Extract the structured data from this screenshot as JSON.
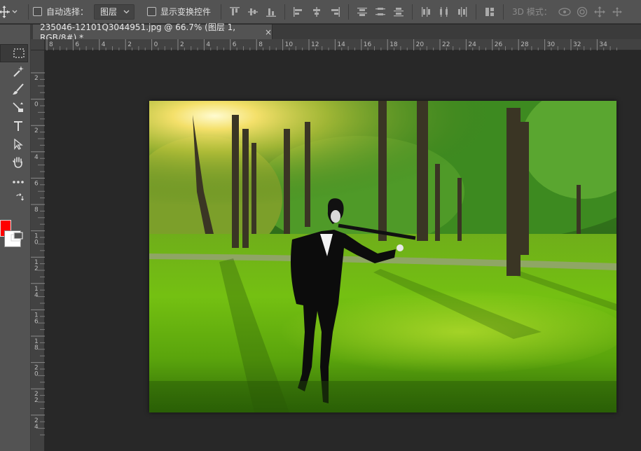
{
  "options_bar": {
    "auto_select_label": "自动选择：",
    "auto_select_target": "图层",
    "show_transform_label": "显示变换控件",
    "mode_3d_label": "3D 模式：",
    "align_icons": [
      "align-top-edges-icon",
      "align-vertical-centers-icon",
      "align-bottom-edges-icon",
      "align-left-edges-icon",
      "align-horizontal-centers-icon",
      "align-right-edges-icon",
      "distribute-top-icon",
      "distribute-vertical-centers-icon",
      "distribute-bottom-icon",
      "distribute-left-icon",
      "distribute-horizontal-centers-icon",
      "distribute-right-icon",
      "auto-align-layers-icon"
    ],
    "mode_3d_icons": [
      "orbit-3d-icon",
      "roll-3d-icon",
      "pan-3d-icon",
      "slide-3d-icon"
    ]
  },
  "document_tab": {
    "title": "235046-12101Q3044951.jpg @ 66.7% (图层 1, RGB/8#) *",
    "close": "×"
  },
  "ruler_h": [
    "8",
    "6",
    "4",
    "2",
    "0",
    "2",
    "4",
    "6",
    "8",
    "10",
    "12",
    "14",
    "16",
    "18",
    "20",
    "22",
    "24",
    "26",
    "28",
    "30",
    "32",
    "34"
  ],
  "ruler_v": [
    "2",
    "0",
    "2",
    "4",
    "6",
    "8",
    "10",
    "12",
    "14",
    "16",
    "18",
    "20",
    "22",
    "24"
  ],
  "toolbar": {
    "tools": [
      "move-tool-icon",
      "marquee-tool-icon",
      "quick-select-tool-icon",
      "brush-tool-icon",
      "clone-stamp-tool-icon",
      "type-tool-icon",
      "path-select-tool-icon",
      "hand-tool-icon",
      "more-tools-icon"
    ],
    "foreground_color": "#ff0000",
    "background_color": "#ffffff"
  },
  "canvas": {
    "zoom": "66.7%",
    "layer": "图层 1",
    "mode": "RGB/8#"
  }
}
